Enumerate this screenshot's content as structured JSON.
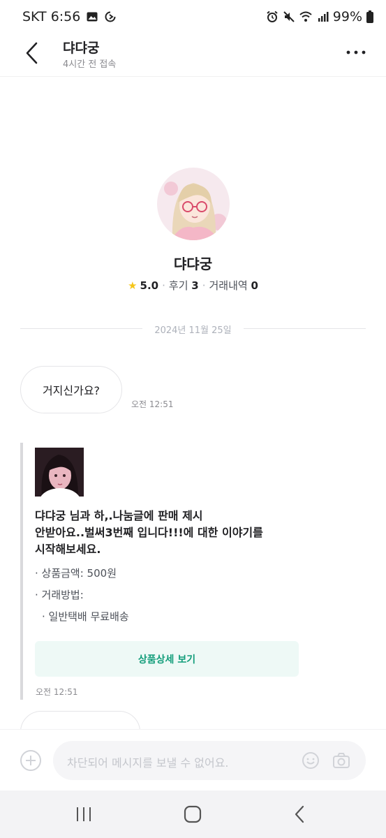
{
  "status_bar": {
    "carrier_time": "SKT 6:56",
    "battery": "99%"
  },
  "header": {
    "title": "댜댜궁",
    "subtitle": "4시간 전 접속"
  },
  "profile": {
    "name": "댜댜궁",
    "rating": "5.0",
    "reviews_label": "후기",
    "reviews_count": "3",
    "trades_label": "거래내역",
    "trades_count": "0"
  },
  "chat": {
    "date_divider": "2024년 11월 25일",
    "messages": [
      {
        "text": "거지신가요?",
        "time": "오전 12:51"
      }
    ],
    "product_card": {
      "intro_lines": [
        "댜댜궁 님과 하,.나눔글에 판매 제시",
        "안받아요..벌써3번째 입니다!!!에 대한 이야기를",
        "시작해보세요."
      ],
      "price_line": "· 상품금액: 500원",
      "method_label": "· 거래방법:",
      "method_value": "· 일반택배 무료배송",
      "button_label": "상품상세 보기",
      "time": "오전 12:51"
    }
  },
  "input": {
    "placeholder": "차단되어 메시지를 보낼 수 없어요."
  },
  "colors": {
    "accent": "#129d7a",
    "accent_bg": "#eef9f6",
    "star": "#f5c518"
  },
  "icons": [
    "image-icon",
    "sync-icon",
    "alarm-icon",
    "mute-icon",
    "wifi-icon",
    "signal-icon",
    "battery-icon",
    "back-arrow-icon",
    "more-icon",
    "star-icon",
    "plus-icon",
    "emoji-icon",
    "camera-icon",
    "recent-apps-icon",
    "home-icon",
    "back-icon"
  ]
}
